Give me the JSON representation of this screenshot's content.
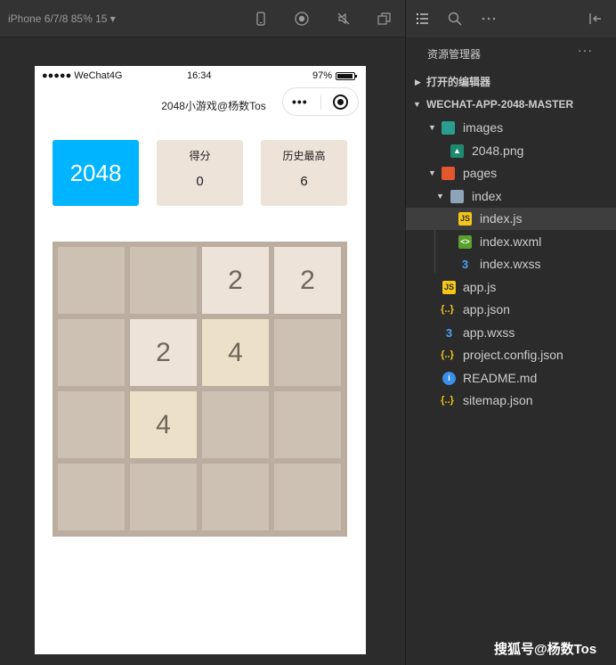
{
  "simulator": {
    "device_label": "iPhone 6/7/8 85% 15 ▾",
    "status": {
      "carrier": "●●●●● WeChat4G",
      "time": "16:34",
      "battery": "97%"
    },
    "nav_title": "2048小游戏@杨数Tos",
    "logo": "2048",
    "score_label": "得分",
    "score_value": "0",
    "best_label": "历史最高",
    "best_value": "6",
    "board": [
      [
        "",
        "",
        "2",
        "2"
      ],
      [
        "",
        "2",
        "4",
        ""
      ],
      [
        "",
        "4",
        "",
        ""
      ],
      [
        "",
        "",
        "",
        ""
      ]
    ]
  },
  "explorer": {
    "title": "资源管理器",
    "more": "···",
    "open_editors": "打开的编辑器",
    "project": "WECHAT-APP-2048-MASTER",
    "tree": {
      "images": "images",
      "png": "2048.png",
      "pages": "pages",
      "index": "index",
      "index_js": "index.js",
      "index_wxml": "index.wxml",
      "index_wxss": "index.wxss",
      "app_js": "app.js",
      "app_json": "app.json",
      "app_wxss": "app.wxss",
      "project_config": "project.config.json",
      "readme": "README.md",
      "sitemap": "sitemap.json"
    }
  },
  "watermark": "搜狐号@杨数Tos",
  "colors": {
    "accent": "#00b4ff",
    "tile2": "#ede3d9",
    "tile4": "#ece0c8",
    "board": "#bbad9f",
    "empty": "#cdc1b3"
  }
}
